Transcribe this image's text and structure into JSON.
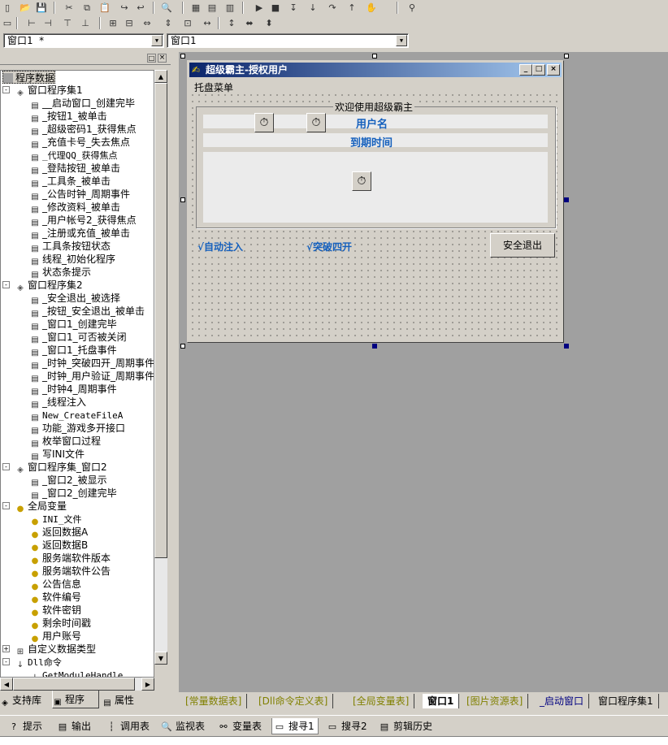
{
  "toolbar": {
    "icons_row1": [
      "new-file-icon",
      "open-folder-icon",
      "save-icon",
      "cut-icon",
      "copy-icon",
      "paste-icon",
      "redo-icon",
      "undo-icon",
      "find-icon",
      "layout-a-icon",
      "layout-b-icon",
      "layout-c-icon",
      "run-icon",
      "stop-icon",
      "step-icon",
      "step-into-icon",
      "step-over-icon",
      "step-out-icon",
      "hand-icon",
      "binoculars-icon"
    ],
    "icons_row2": [
      "form-icon",
      "align-left-icon",
      "align-center-icon",
      "align-right-icon",
      "align-top-icon",
      "align-middle-icon",
      "align-bottom-icon",
      "same-width-icon",
      "same-height-icon",
      "same-size-icon",
      "hspace-icon",
      "vspace-icon",
      "center-h-icon",
      "center-v-icon"
    ]
  },
  "selectors": {
    "window_combo": "窗口1 *",
    "event_combo": "窗口1"
  },
  "tree": {
    "root": "程序数据",
    "rows": [
      {
        "label": "窗口程序集1",
        "level": 1,
        "icon": "assembly",
        "expand": "-"
      },
      {
        "label": "__启动窗口_创建完毕",
        "level": 2,
        "icon": "sub"
      },
      {
        "label": "_按钮1_被单击",
        "level": 2,
        "icon": "sub"
      },
      {
        "label": "_超级密码1_获得焦点",
        "level": 2,
        "icon": "sub"
      },
      {
        "label": "_充值卡号_失去焦点",
        "level": 2,
        "icon": "sub"
      },
      {
        "label": "_代理QQ_获得焦点",
        "level": 2,
        "icon": "sub"
      },
      {
        "label": "_登陆按钮_被单击",
        "level": 2,
        "icon": "sub"
      },
      {
        "label": "_工具条_被单击",
        "level": 2,
        "icon": "sub"
      },
      {
        "label": "_公告时钟_周期事件",
        "level": 2,
        "icon": "sub"
      },
      {
        "label": "_修改资料_被单击",
        "level": 2,
        "icon": "sub"
      },
      {
        "label": "_用户帐号2_获得焦点",
        "level": 2,
        "icon": "sub"
      },
      {
        "label": "_注册或充值_被单击",
        "level": 2,
        "icon": "sub"
      },
      {
        "label": "工具条按钮状态",
        "level": 2,
        "icon": "sub"
      },
      {
        "label": "线程_初始化程序",
        "level": 2,
        "icon": "sub"
      },
      {
        "label": "状态条提示",
        "level": 2,
        "icon": "sub"
      },
      {
        "label": "窗口程序集2",
        "level": 1,
        "icon": "assembly",
        "expand": "-"
      },
      {
        "label": "_安全退出_被选择",
        "level": 2,
        "icon": "sub"
      },
      {
        "label": "_按钮_安全退出_被单击",
        "level": 2,
        "icon": "sub"
      },
      {
        "label": "_窗口1_创建完毕",
        "level": 2,
        "icon": "sub"
      },
      {
        "label": "_窗口1_可否被关闭",
        "level": 2,
        "icon": "sub"
      },
      {
        "label": "_窗口1_托盘事件",
        "level": 2,
        "icon": "sub"
      },
      {
        "label": "_时钟_突破四开_周期事件",
        "level": 2,
        "icon": "sub"
      },
      {
        "label": "_时钟_用户验证_周期事件",
        "level": 2,
        "icon": "sub"
      },
      {
        "label": "_时钟4_周期事件",
        "level": 2,
        "icon": "sub"
      },
      {
        "label": "_线程注入",
        "level": 2,
        "icon": "sub"
      },
      {
        "label": "New_CreateFileA",
        "level": 2,
        "icon": "sub"
      },
      {
        "label": "功能_游戏多开接口",
        "level": 2,
        "icon": "sub"
      },
      {
        "label": "枚举窗口过程",
        "level": 2,
        "icon": "sub"
      },
      {
        "label": "写INI文件",
        "level": 2,
        "icon": "sub"
      },
      {
        "label": "窗口程序集_窗口2",
        "level": 1,
        "icon": "assembly",
        "expand": "-"
      },
      {
        "label": "_窗口2_被显示",
        "level": 2,
        "icon": "sub"
      },
      {
        "label": "_窗口2_创建完毕",
        "level": 2,
        "icon": "sub"
      },
      {
        "label": "全局变量",
        "level": 1,
        "icon": "var",
        "expand": "-"
      },
      {
        "label": "INI_文件",
        "level": 2,
        "icon": "var"
      },
      {
        "label": "返回数据A",
        "level": 2,
        "icon": "var"
      },
      {
        "label": "返回数据B",
        "level": 2,
        "icon": "var"
      },
      {
        "label": "服务端软件版本",
        "level": 2,
        "icon": "var"
      },
      {
        "label": "服务端软件公告",
        "level": 2,
        "icon": "var"
      },
      {
        "label": "公告信息",
        "level": 2,
        "icon": "var"
      },
      {
        "label": "软件编号",
        "level": 2,
        "icon": "var"
      },
      {
        "label": "软件密钥",
        "level": 2,
        "icon": "var"
      },
      {
        "label": "剩余时间戳",
        "level": 2,
        "icon": "var"
      },
      {
        "label": "用户账号",
        "level": 2,
        "icon": "var"
      },
      {
        "label": "自定义数据类型",
        "level": 1,
        "icon": "type",
        "expand": "+"
      },
      {
        "label": "Dll命令",
        "level": 1,
        "icon": "dll",
        "expand": "-"
      },
      {
        "label": "GetModuleHandle",
        "level": 2,
        "icon": "dll"
      }
    ]
  },
  "left_tabs": [
    "支持库",
    "程序",
    "属性"
  ],
  "form": {
    "title": "超级霸主-授权用户",
    "menu": "托盘菜单",
    "group_title": "欢迎使用超级霸主",
    "header_username": "用户名",
    "header_expire": "到期时间",
    "check_inject": "√自动注入",
    "check_break": "√突破四开",
    "exit_button": "安全退出"
  },
  "doc_tabs": [
    "[常量数据表]",
    "[Dll命令定义表]",
    "[全局变量表]",
    "窗口1",
    "[图片资源表]",
    "_启动窗口",
    "窗口程序集1"
  ],
  "bottom_tabs": [
    {
      "label": "提示",
      "icon": "question-icon"
    },
    {
      "label": "输出",
      "icon": "output-icon"
    },
    {
      "label": "调用表",
      "icon": "call-table-icon"
    },
    {
      "label": "监视表",
      "icon": "watch-icon"
    },
    {
      "label": "变量表",
      "icon": "variable-icon"
    },
    {
      "label": "搜寻1",
      "icon": "search1-icon"
    },
    {
      "label": "搜寻2",
      "icon": "search2-icon"
    },
    {
      "label": "剪辑历史",
      "icon": "clip-history-icon"
    }
  ]
}
